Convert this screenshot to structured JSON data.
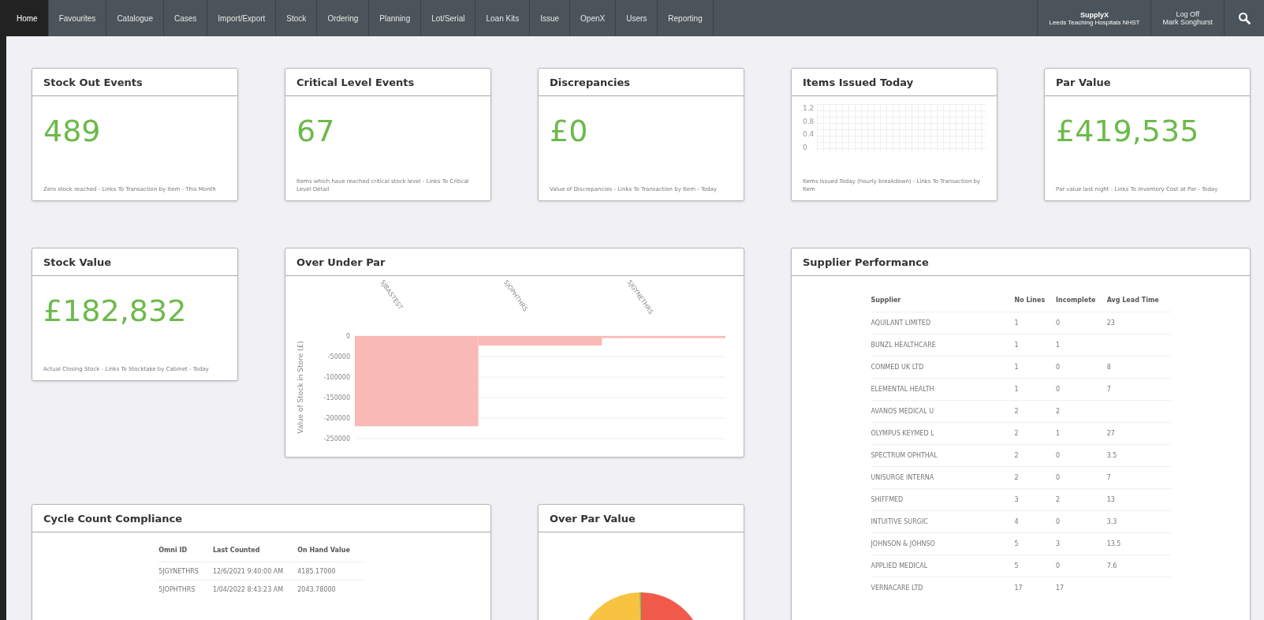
{
  "nav": {
    "tabs": [
      {
        "label": "Home",
        "selected": true
      },
      {
        "label": "Favourites",
        "selected": false
      },
      {
        "label": "Catalogue",
        "selected": false
      },
      {
        "label": "Cases",
        "selected": false
      },
      {
        "label": "Import/Export",
        "selected": false
      },
      {
        "label": "Stock",
        "selected": false
      },
      {
        "label": "Ordering",
        "selected": false
      },
      {
        "label": "Planning",
        "selected": false
      },
      {
        "label": "Lot/Serial",
        "selected": false
      },
      {
        "label": "Loan Kits",
        "selected": false
      },
      {
        "label": "Issue",
        "selected": false
      },
      {
        "label": "OpenX",
        "selected": false
      },
      {
        "label": "Users",
        "selected": false
      },
      {
        "label": "Reporting",
        "selected": false
      }
    ],
    "site": {
      "name": "SupplyX",
      "org": "Leeds Teaching Hospitals NHST"
    },
    "user": {
      "action": "Log Off",
      "name": "Mark Songhurst"
    }
  },
  "kpis": [
    {
      "title": "Stock Out Events",
      "value": "489",
      "description": "Zero stock reached - Links To Transaction by Item - This Month"
    },
    {
      "title": "Critical Level Events",
      "value": "67",
      "description": "Items which have reached critical stock level - Links To Critical Level Detail"
    },
    {
      "title": "Discrepancies",
      "value": "£0",
      "description": "Value of Discrepancies - Links To Transaction by Item - Today"
    },
    {
      "title": "Items Issued Today",
      "y_axis_labels": [
        "1.2",
        "0.8",
        "0.4",
        "0"
      ],
      "description": "Items Issued Today (hourly breakdown) - Links To Transaction by Item"
    },
    {
      "title": "Par Value",
      "value": "£419,535",
      "description": "Par value last night - Links To Inventory Cost at Par - Today"
    }
  ],
  "stock_value": {
    "title": "Stock Value",
    "value": "£182,832",
    "description": "Actual Closing Stock - Links To Stocktake by Cabinet - Today"
  },
  "over_under_par": {
    "title": "Over Under Par",
    "chart_data": {
      "type": "bar",
      "ylabel": "Value of Stock in Store (£)",
      "categories": [
        "5JBASTEST",
        "5JOPHTHRS",
        "5JGYNETHRS"
      ],
      "values": [
        -220000,
        -23000,
        -5000
      ],
      "ylim": [
        -250000,
        0
      ],
      "grid": true,
      "yticks": [
        0,
        -50000,
        -100000,
        -150000,
        -200000,
        -250000
      ]
    }
  },
  "supplier_performance": {
    "title": "Supplier Performance",
    "columns": [
      "Supplier",
      "No Lines",
      "Incomplete",
      "Avg Lead Time"
    ],
    "rows": [
      [
        "AQUILANT LIMITED",
        "1",
        "0",
        "23"
      ],
      [
        "BUNZL HEALTHCARE",
        "1",
        "1",
        ""
      ],
      [
        "CONMED UK LTD",
        "1",
        "0",
        "8"
      ],
      [
        "ELEMENTAL HEALTH",
        "1",
        "0",
        "7"
      ],
      [
        "AVANOS MEDICAL U",
        "2",
        "2",
        ""
      ],
      [
        "OLYMPUS KEYMED L",
        "2",
        "1",
        "27"
      ],
      [
        "SPECTRUM OPHTHAL",
        "2",
        "0",
        "3.5"
      ],
      [
        "UNISURGE INTERNA",
        "2",
        "0",
        "7"
      ],
      [
        "SHIFFMED",
        "3",
        "2",
        "13"
      ],
      [
        "INTUITIVE SURGIC",
        "4",
        "0",
        "3.3"
      ],
      [
        "JOHNSON & JOHNSO",
        "5",
        "3",
        "13.5"
      ],
      [
        "APPLIED MEDICAL",
        "5",
        "0",
        "7.6"
      ],
      [
        "VERNACARE LTD",
        "17",
        "17",
        ""
      ]
    ]
  },
  "cycle_count": {
    "title": "Cycle Count Compliance",
    "columns": [
      "Omni ID",
      "Last Counted",
      "On Hand Value"
    ],
    "rows": [
      [
        "5JGYNETHRS",
        "12/6/2021 9:40:00 AM",
        "4185.17000"
      ],
      [
        "5JOPHTHRS",
        "1/04/2022 8:43:23 AM",
        "2043.78000"
      ]
    ]
  },
  "over_par_value": {
    "title": "Over Par Value"
  }
}
